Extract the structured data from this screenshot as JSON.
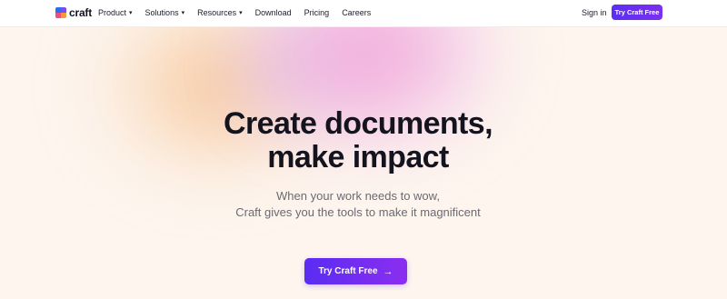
{
  "nav": {
    "logo_text": "craft",
    "items": [
      {
        "label": "Product",
        "has_dropdown": true
      },
      {
        "label": "Solutions",
        "has_dropdown": true
      },
      {
        "label": "Resources",
        "has_dropdown": true
      },
      {
        "label": "Download",
        "has_dropdown": false
      },
      {
        "label": "Pricing",
        "has_dropdown": false
      },
      {
        "label": "Careers",
        "has_dropdown": false
      }
    ],
    "signin_label": "Sign in",
    "cta_label": "Try Craft Free"
  },
  "hero": {
    "headline_line1": "Create documents,",
    "headline_line2": "make impact",
    "subtitle_line1": "When your work needs to wow,",
    "subtitle_line2": "Craft gives you the tools to make it magnificent",
    "cta_label": "Try Craft Free",
    "cta_icon": "arrow-right-icon"
  },
  "colors": {
    "accent": "#5b2ff2",
    "accent_end": "#8a2ef0",
    "background": "#fdf5ee",
    "headline": "#14141f",
    "subtitle": "#6a6a74"
  }
}
